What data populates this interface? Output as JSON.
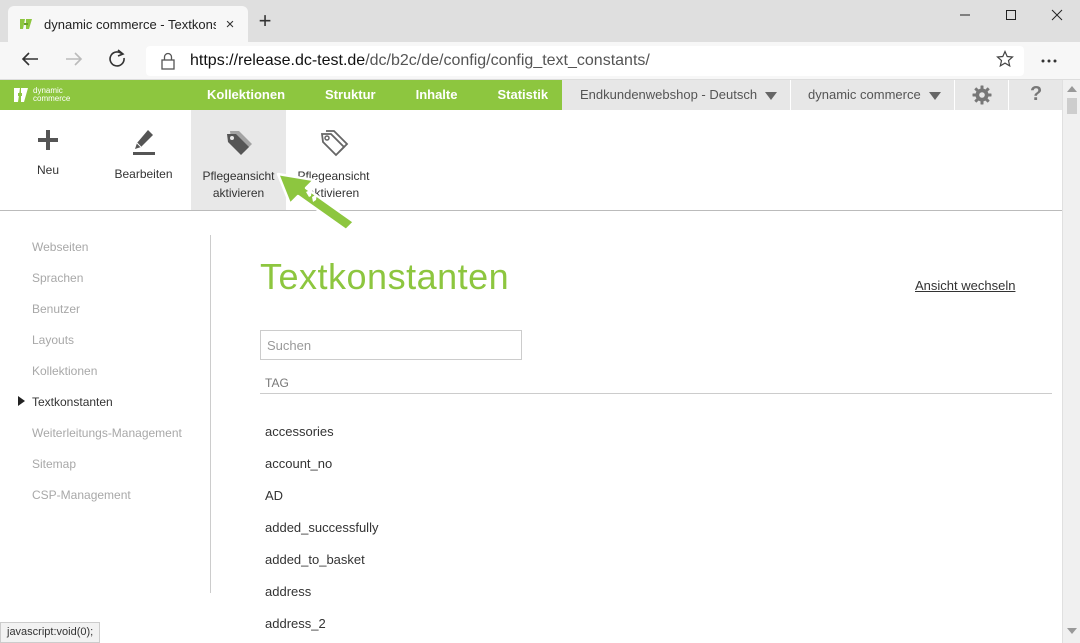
{
  "browser": {
    "tab_title": "dynamic commerce - Textkonstanten",
    "tab_close": "×",
    "new_tab": "+",
    "url_host": "https://release.dc-test.de",
    "url_path": "/dc/b2c/de/config/config_text_constants/",
    "status_text": "javascript:void(0);"
  },
  "app": {
    "logo_text_1": "dynamic",
    "logo_text_2": "commerce",
    "main_nav": [
      "Kollektionen",
      "Struktur",
      "Inhalte",
      "Statistik"
    ],
    "shop_select": "Endkundenwebshop - Deutsch",
    "tenant_select": "dynamic commerce",
    "help_label": "?"
  },
  "toolbar": {
    "new_label": "Neu",
    "edit_label": "Bearbeiten",
    "activate_label_1": "Pflegeansicht",
    "activate_label_2": "aktivieren",
    "deactivate_label_1": "Pflegeansicht",
    "deactivate_label_2": "aktivieren"
  },
  "sidebar": {
    "items": [
      {
        "label": "Webseiten"
      },
      {
        "label": "Sprachen"
      },
      {
        "label": "Benutzer"
      },
      {
        "label": "Layouts"
      },
      {
        "label": "Kollektionen"
      },
      {
        "label": "Textkonstanten"
      },
      {
        "label": "Weiterleitungs-Management"
      },
      {
        "label": "Sitemap"
      },
      {
        "label": "CSP-Management"
      }
    ],
    "active_index": 5
  },
  "main": {
    "title": "Textkonstanten",
    "switch_view": "Ansicht wechseln",
    "search_placeholder": "Suchen",
    "column_header": "TAG",
    "rows": [
      "accessories",
      "account_no",
      "AD",
      "added_successfully",
      "added_to_basket",
      "address",
      "address_2"
    ]
  },
  "colors": {
    "brand_green": "#8dc63f",
    "nav_grey": "#e7e7e7"
  }
}
